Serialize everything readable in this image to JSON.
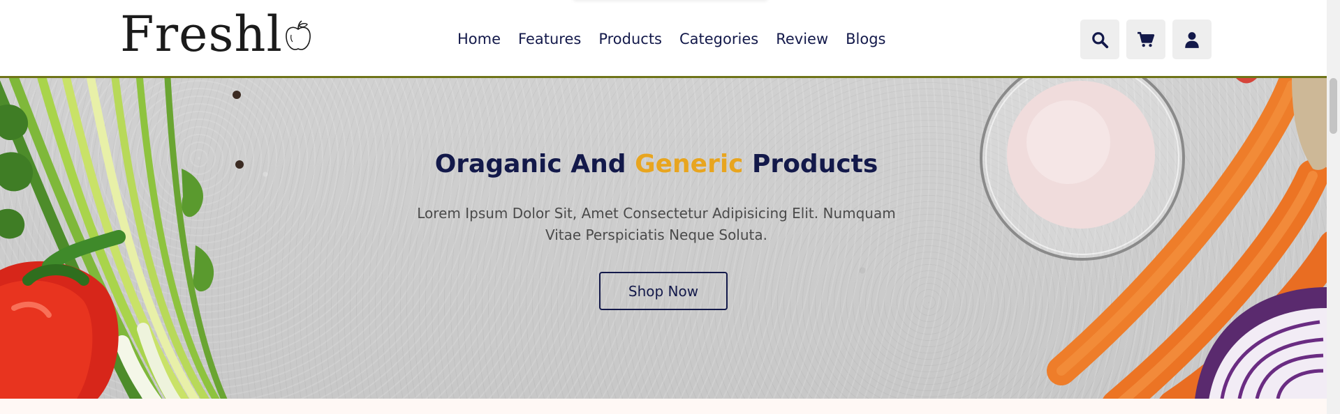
{
  "header": {
    "logo_text": "Freshl",
    "nav": [
      "Home",
      "Features",
      "Products",
      "Categories",
      "Review",
      "Blogs"
    ],
    "icons": [
      "search-icon",
      "cart-icon",
      "user-icon"
    ]
  },
  "hero": {
    "title_part1": "Oraganic And ",
    "title_accent": "Generic",
    "title_part2": " Products",
    "subtitle": "Lorem Ipsum Dolor Sit, Amet Consectetur Adipisicing Elit. Numquam Vitae Perspiciatis Neque Soluta.",
    "button_label": "Shop Now"
  },
  "colors": {
    "primary": "#13194a",
    "accent": "#e8a51f",
    "header_border": "#6f7418",
    "icon_bg": "#eeeeee"
  }
}
